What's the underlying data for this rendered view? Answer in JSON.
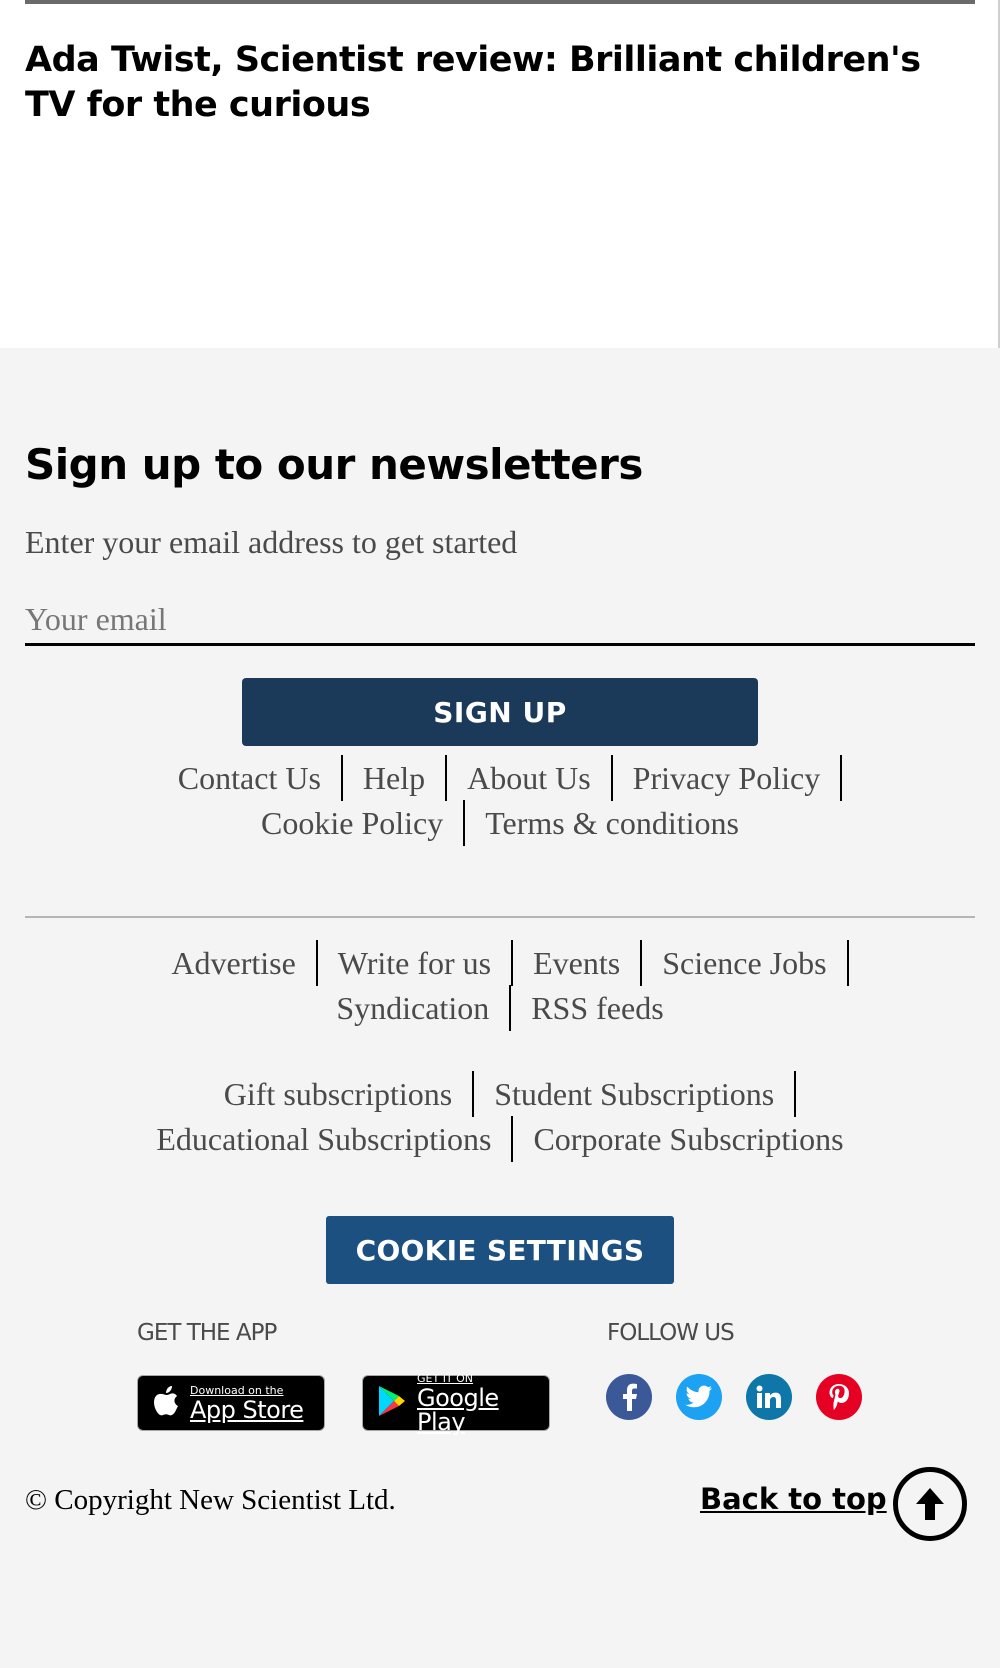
{
  "article": {
    "title": "Ada Twist, Scientist review: Brilliant children's TV for the curious"
  },
  "newsletter": {
    "title": "Sign up to our newsletters",
    "subtitle": "Enter your email address to get started",
    "email_placeholder": "Your email",
    "signup_label": "SIGN UP"
  },
  "links_primary": {
    "row1": [
      "Contact Us",
      "Help",
      "About Us",
      "Privacy Policy"
    ],
    "row2": [
      "Cookie Policy",
      "Terms & conditions"
    ]
  },
  "links_secondary": {
    "row1": [
      "Advertise",
      "Write for us",
      "Events",
      "Science Jobs"
    ],
    "row2": [
      "Syndication",
      "RSS feeds"
    ]
  },
  "links_subscriptions": {
    "row1": [
      "Gift subscriptions",
      "Student Subscriptions"
    ],
    "row2": [
      "Educational Subscriptions",
      "Corporate Subscriptions"
    ]
  },
  "cookie_settings_label": "COOKIE SETTINGS",
  "app": {
    "label": "GET THE APP",
    "app_store": {
      "small": "Download on the",
      "big": "App Store",
      "icon": "apple-icon"
    },
    "google_play": {
      "small": "GET IT ON",
      "big": "Google Play",
      "icon": "google-play-icon"
    }
  },
  "follow": {
    "label": "FOLLOW US",
    "networks": [
      {
        "name": "facebook",
        "color": "#3b5998"
      },
      {
        "name": "twitter",
        "color": "#1da1f2"
      },
      {
        "name": "linkedin",
        "color": "#0e76a8"
      },
      {
        "name": "pinterest",
        "color": "#e60023"
      }
    ]
  },
  "footer": {
    "copyright": "© Copyright New Scientist Ltd.",
    "back_to_top": "Back to top"
  },
  "colors": {
    "signup_button": "#1b3a5a",
    "cookie_button": "#1c5080",
    "footer_bg": "#f4f4f4"
  }
}
